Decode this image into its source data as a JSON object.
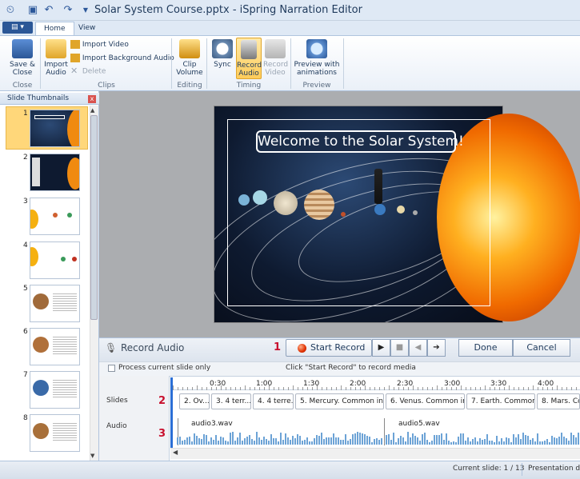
{
  "window": {
    "title": "Solar System Course.pptx - iSpring Narration Editor"
  },
  "tabs": [
    {
      "label": "Home"
    },
    {
      "label": "View"
    }
  ],
  "ribbon": {
    "save_close": "Save &\nClose",
    "import_audio": "Import\nAudio",
    "import_video": "Import Video",
    "import_bg_audio": "Import Background Audio",
    "delete": "Delete",
    "clip_volume": "Clip\nVolume",
    "sync": "Sync",
    "record_audio": "Record\nAudio",
    "record_video": "Record\nVideo",
    "preview": "Preview with\nanimations",
    "groups": {
      "close": "Close",
      "clips": "Clips",
      "editing": "Editing",
      "timing": "Timing",
      "preview": "Preview"
    }
  },
  "thumbnails": {
    "title": "Slide Thumbnails",
    "close_glyph": "x",
    "items": [
      {
        "number": "1"
      },
      {
        "number": "2"
      },
      {
        "number": "3"
      },
      {
        "number": "4"
      },
      {
        "number": "5"
      },
      {
        "number": "6"
      },
      {
        "number": "7"
      },
      {
        "number": "8"
      }
    ]
  },
  "slide": {
    "heading": "Welcome to the Solar System!"
  },
  "record_panel": {
    "title": "Record Audio",
    "marker_1": "1",
    "start_record": "Start Record",
    "done": "Done",
    "cancel": "Cancel",
    "process_current_slide": "Process current slide only",
    "hint": "Click \"Start Record\" to record media"
  },
  "timeline": {
    "slides_label": "Slides",
    "audio_label": "Audio",
    "marker_2": "2",
    "marker_3": "3",
    "ticks": [
      "0:30",
      "1:00",
      "1:30",
      "2:00",
      "2:30",
      "3:00",
      "3:30",
      "4:00"
    ],
    "segments": [
      "2. Ov...",
      "3. 4 terr...",
      "4. 4 terre...",
      "5. Mercury. Common info...",
      "6. Venus. Common in...",
      "7. Earth. Common ...",
      "8. Mars. Comm"
    ],
    "audio_clips": [
      "audio3.wav",
      "audio5.wav"
    ]
  },
  "status": {
    "current_slide": "Current slide: 1 / 13",
    "presentation": "Presentation du"
  },
  "colors": {
    "accent": "#2b5797",
    "selection": "#ffd77a",
    "record": "#c8102e"
  }
}
